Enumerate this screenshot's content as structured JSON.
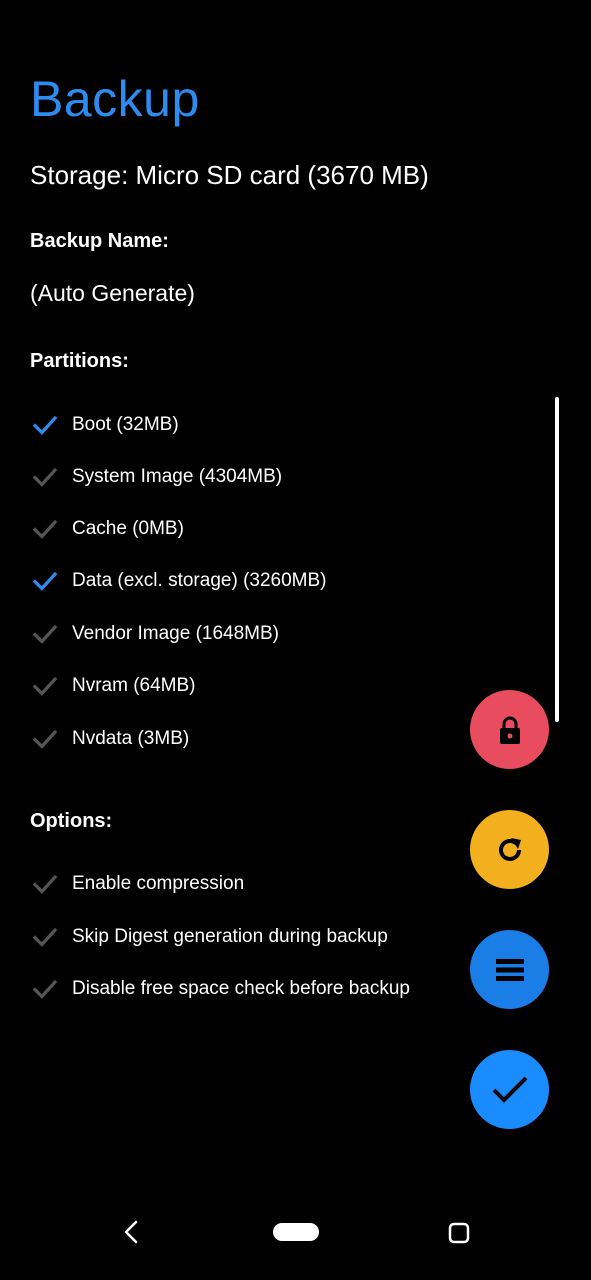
{
  "page": {
    "title": "Backup",
    "storage_text": "Storage: Micro SD card (3670 MB)"
  },
  "backup_name": {
    "label": "Backup Name:",
    "value": "(Auto Generate)"
  },
  "partitions": {
    "label": "Partitions:",
    "items": [
      {
        "label": "Boot (32MB)",
        "checked": true
      },
      {
        "label": "System Image (4304MB)",
        "checked": false
      },
      {
        "label": "Cache (0MB)",
        "checked": false
      },
      {
        "label": "Data (excl. storage) (3260MB)",
        "checked": true
      },
      {
        "label": "Vendor Image (1648MB)",
        "checked": false
      },
      {
        "label": "Nvram (64MB)",
        "checked": false
      },
      {
        "label": "Nvdata (3MB)",
        "checked": false
      }
    ]
  },
  "options": {
    "label": "Options:",
    "items": [
      {
        "label": "Enable compression",
        "checked": false
      },
      {
        "label": "Skip Digest generation during backup",
        "checked": false
      },
      {
        "label": "Disable free space check before backup",
        "checked": false
      }
    ]
  },
  "fabs": [
    {
      "icon": "lock-icon",
      "color": "#e84c5e"
    },
    {
      "icon": "refresh-icon",
      "color": "#f2b01e"
    },
    {
      "icon": "list-icon",
      "color": "#1a7ee6"
    },
    {
      "icon": "check-icon",
      "color": "#1a8cff"
    }
  ],
  "colors": {
    "accent": "#2d8cf0",
    "check_on": "#2d8cf0",
    "check_off": "#555555"
  },
  "navbar": {
    "back_icon": "back-icon",
    "home_icon": "home-pill-icon",
    "recents_icon": "recents-icon"
  }
}
